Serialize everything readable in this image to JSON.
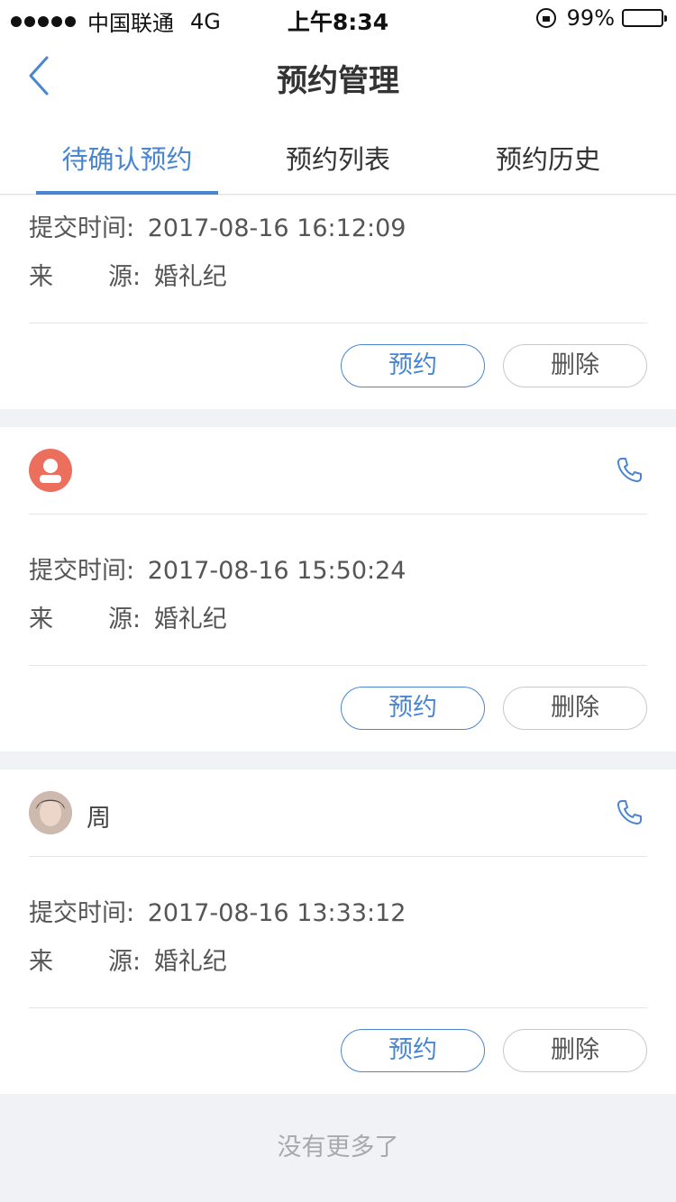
{
  "status_bar": {
    "carrier": "中国联通",
    "network": "4G",
    "time": "上午8:34",
    "battery": "99%",
    "battery_level": 0.99
  },
  "nav": {
    "title": "预约管理",
    "back_icon": "chevron-left-icon"
  },
  "tabs": [
    {
      "label": "待确认预约",
      "active": true
    },
    {
      "label": "预约列表",
      "active": false
    },
    {
      "label": "预约历史",
      "active": false
    }
  ],
  "labels": {
    "submit_time": "提交时间:",
    "source_char1": "来",
    "source_char2": "源:",
    "book": "预约",
    "delete": "删除"
  },
  "cards": [
    {
      "submit_time": "2017-08-16 16:12:09",
      "source": "婚礼纪"
    },
    {
      "user_name": "",
      "submit_time": "2017-08-16 15:50:24",
      "source": "婚礼纪"
    },
    {
      "user_name": "周",
      "submit_time": "2017-08-16 13:33:12",
      "source": "婚礼纪"
    }
  ],
  "footer": {
    "no_more": "没有更多了"
  },
  "colors": {
    "accent": "#4a86d0",
    "avatar_default": "#ec6e5c",
    "background": "#f1f2f6"
  }
}
